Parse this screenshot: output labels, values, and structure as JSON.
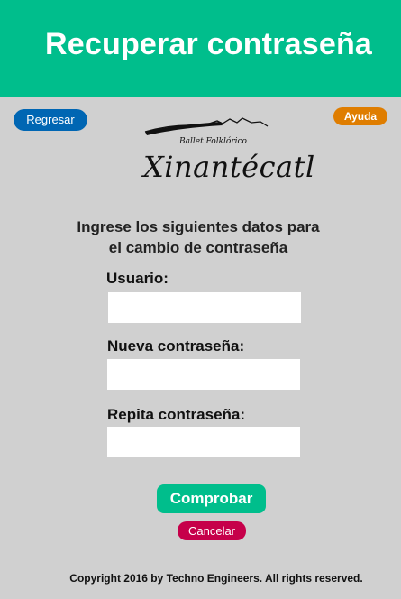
{
  "header": {
    "title": "Recuperar contraseña"
  },
  "nav": {
    "back_label": "Regresar",
    "help_label": "Ayuda"
  },
  "logo": {
    "subtitle": "Ballet Folklórico",
    "brand": "Xinantécatl"
  },
  "form": {
    "instructions_line1": "Ingrese los siguientes datos para",
    "instructions_line2": "el cambio de contraseña",
    "username_label": "Usuario:",
    "username_value": "",
    "new_password_label": "Nueva contraseña:",
    "new_password_value": "",
    "repeat_password_label": "Repita contraseña:",
    "repeat_password_value": "",
    "submit_label": "Comprobar",
    "cancel_label": "Cancelar"
  },
  "footer": {
    "copyright": "Copyright 2016 by Techno Engineers. All rights reserved."
  },
  "colors": {
    "header": "#00be8c",
    "back_button": "#0066b3",
    "help_button": "#df7d00",
    "cancel_button": "#c6004a",
    "background": "#d0d0d0"
  }
}
